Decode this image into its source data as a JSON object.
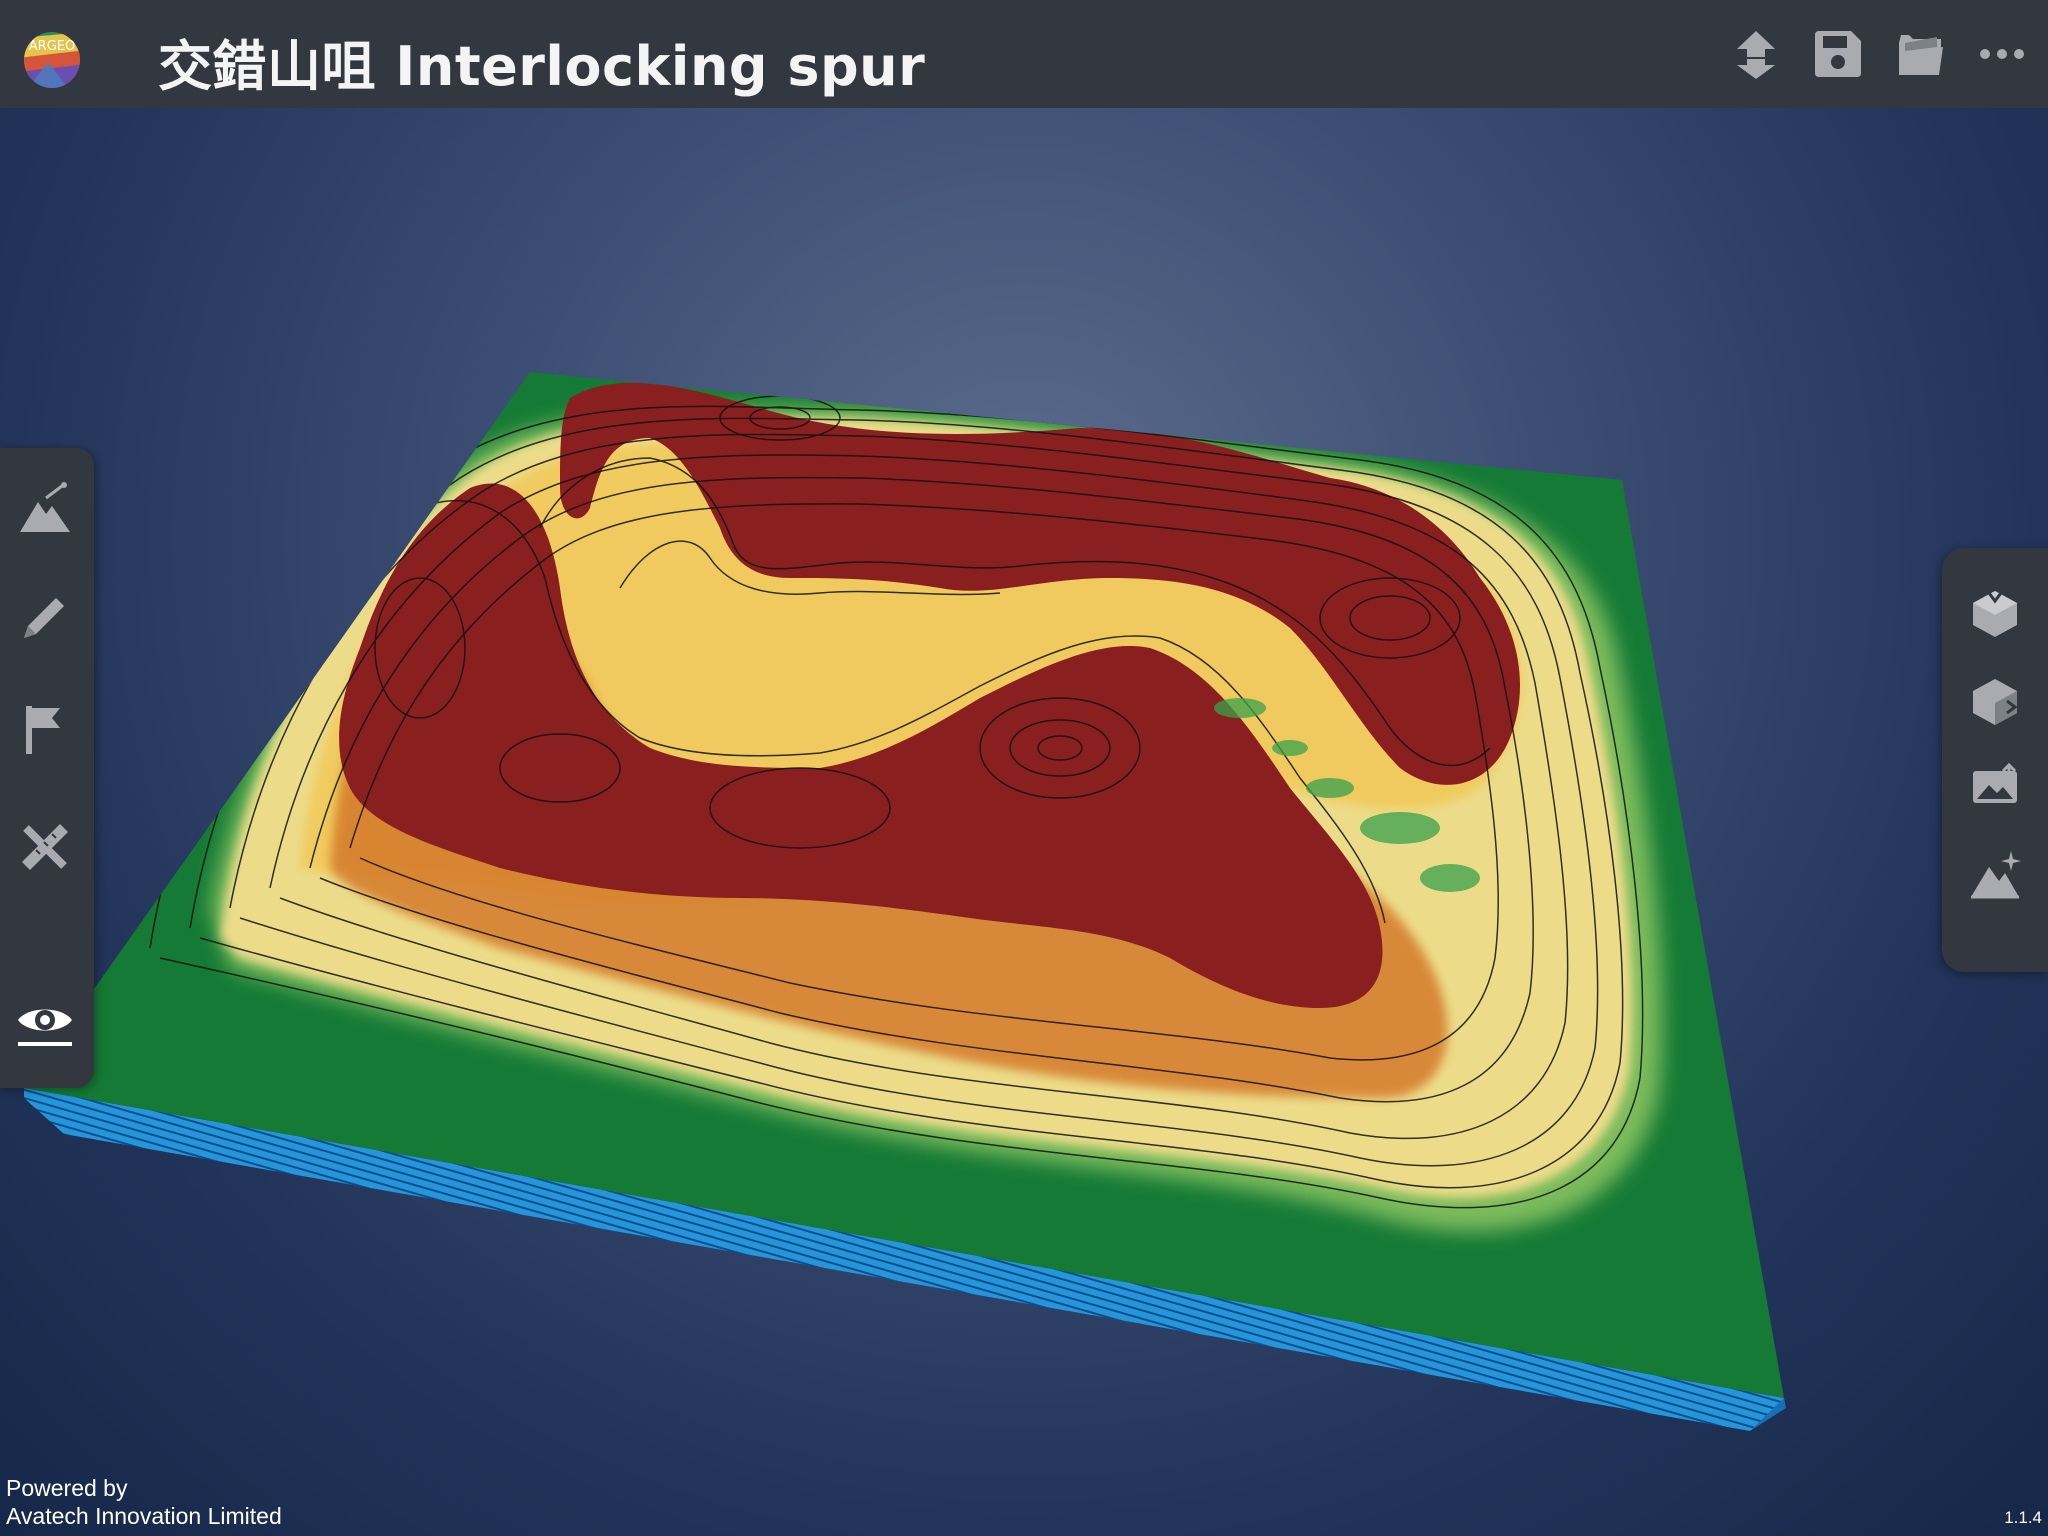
{
  "app": {
    "title": "交錯山咀 Interlocking spur",
    "logo_text": "ARGEO",
    "version": "1.1.4"
  },
  "footer": {
    "powered_line1": "Powered by",
    "powered_line2": "Avatech Innovation Limited"
  },
  "top_actions": [
    {
      "icon": "download-upload-icon"
    },
    {
      "icon": "save-icon"
    },
    {
      "icon": "open-folder-icon"
    },
    {
      "icon": "more-icon"
    }
  ],
  "left_tools": [
    {
      "icon": "terrain-edit-icon"
    },
    {
      "icon": "pencil-icon"
    },
    {
      "icon": "flag-icon"
    },
    {
      "icon": "ruler-pencil-icon"
    },
    {
      "icon": "eye-icon"
    }
  ],
  "right_tools": [
    {
      "icon": "cube-top-icon"
    },
    {
      "icon": "cube-side-icon"
    },
    {
      "icon": "image-upload-icon"
    },
    {
      "icon": "terrain-sparkle-icon"
    }
  ],
  "colors": {
    "topbar": "#333740",
    "toolbar": "#33373f",
    "peak": "#8a1f1f",
    "high": "#d47a2a",
    "mid": "#f1c95a",
    "low": "#ecdc8a",
    "base": "#147a35",
    "water_edge": "#1e8fd6"
  }
}
